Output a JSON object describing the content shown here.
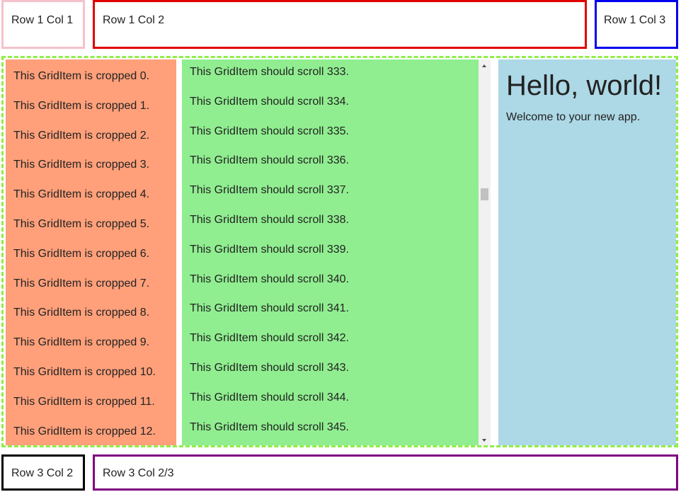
{
  "row1": {
    "col1": "Row 1 Col 1",
    "col2": "Row 1 Col 2",
    "col3": "Row 1 Col 3"
  },
  "row3": {
    "col2": "Row 3 Col 2",
    "col23": "Row 3 Col 2/3"
  },
  "cropped_items": [
    "This GridItem is cropped 0.",
    "This GridItem is cropped 1.",
    "This GridItem is cropped 2.",
    "This GridItem is cropped 3.",
    "This GridItem is cropped 4.",
    "This GridItem is cropped 5.",
    "This GridItem is cropped 6.",
    "This GridItem is cropped 7.",
    "This GridItem is cropped 8.",
    "This GridItem is cropped 9.",
    "This GridItem is cropped 10.",
    "This GridItem is cropped 11.",
    "This GridItem is cropped 12."
  ],
  "scroll_items": [
    "This GridItem should scroll 333.",
    "This GridItem should scroll 334.",
    "This GridItem should scroll 335.",
    "This GridItem should scroll 336.",
    "This GridItem should scroll 337.",
    "This GridItem should scroll 338.",
    "This GridItem should scroll 339.",
    "This GridItem should scroll 340.",
    "This GridItem should scroll 341.",
    "This GridItem should scroll 342.",
    "This GridItem should scroll 343.",
    "This GridItem should scroll 344.",
    "This GridItem should scroll 345."
  ],
  "hello": {
    "title": "Hello, world!",
    "subtitle": "Welcome to your new app."
  },
  "colors": {
    "row1_col1_border": "#f4c2cc",
    "row1_col2_border": "#e00000",
    "row1_col3_border": "#0000ee",
    "row3_col2_border": "#000000",
    "row3_col23_border": "#800080",
    "middle_border": "#90ee46",
    "cropped_bg": "#ffa07a",
    "scroll_bg": "#90ee90",
    "hello_bg": "#add8e6"
  },
  "icons": {
    "scroll_up": "scroll-up-arrow-icon",
    "scroll_down": "scroll-down-arrow-icon"
  }
}
